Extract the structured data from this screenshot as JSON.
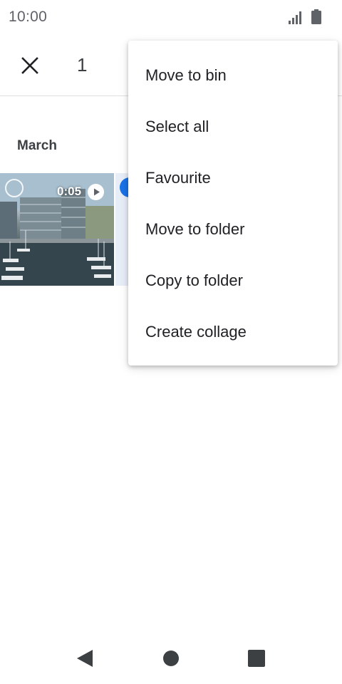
{
  "status_bar": {
    "time": "10:00",
    "icons": [
      "signal-icon",
      "battery-icon"
    ]
  },
  "app_bar": {
    "close_icon": "close-icon",
    "selection_count": "1"
  },
  "content": {
    "section_header": "March",
    "thumbnails": [
      {
        "type": "video",
        "duration": "0:05",
        "selected": false,
        "icon": "play-icon"
      },
      {
        "type": "photo",
        "selected": true,
        "icon": "check-icon"
      }
    ]
  },
  "menu": {
    "items": [
      {
        "label": "Move to bin"
      },
      {
        "label": "Select all"
      },
      {
        "label": "Favourite"
      },
      {
        "label": "Move to folder"
      },
      {
        "label": "Copy to folder"
      },
      {
        "label": "Create collage"
      }
    ]
  },
  "nav_bar": {
    "icons": [
      "back-icon",
      "home-icon",
      "recents-icon"
    ]
  },
  "colors": {
    "accent": "#1a73e8",
    "text_primary": "#202124",
    "text_secondary": "#5f6368",
    "divider": "#e0e0e0"
  }
}
